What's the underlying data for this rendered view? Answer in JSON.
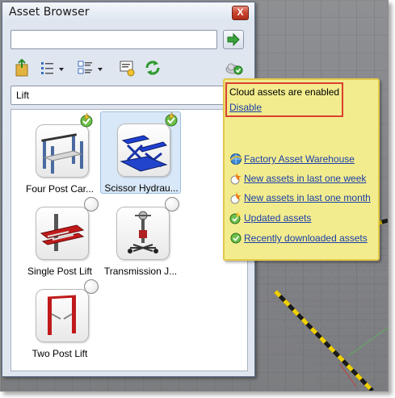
{
  "window": {
    "title": "Asset Browser",
    "close_glyph": "X"
  },
  "search": {
    "value": "",
    "placeholder": ""
  },
  "toolbar": {
    "icons": [
      "import-icon",
      "list-view-icon",
      "thumbnail-view-icon",
      "tooltip-icon",
      "refresh-icon",
      "cloud-icon"
    ]
  },
  "category": {
    "selected": "Lift"
  },
  "assets": [
    {
      "label": "Four Post Car...",
      "status": "updated"
    },
    {
      "label": "Scissor Hydrau...",
      "status": "updated",
      "selected": true
    },
    {
      "label": "Single Post Lift",
      "status": "not-downloaded"
    },
    {
      "label": "Transmission J...",
      "status": "not-downloaded"
    },
    {
      "label": "Two Post Lift",
      "status": "not-downloaded"
    }
  ],
  "cloud_popup": {
    "status_text": "Cloud assets are enabled",
    "disable_label": "Disable",
    "links": [
      {
        "label": "Factory Asset Warehouse",
        "icon": "globe-icon"
      },
      {
        "label": "New assets in last one week",
        "icon": "new-asset-icon"
      },
      {
        "label": "New assets in last one month",
        "icon": "new-asset-icon"
      },
      {
        "label": "Updated assets",
        "icon": "updated-asset-icon"
      },
      {
        "label": "Recently downloaded assets",
        "icon": "downloaded-asset-icon"
      }
    ]
  },
  "colors": {
    "link": "#1a3fa8",
    "popup_bg": "#f3ec8e",
    "highlight": "#d9402f"
  }
}
